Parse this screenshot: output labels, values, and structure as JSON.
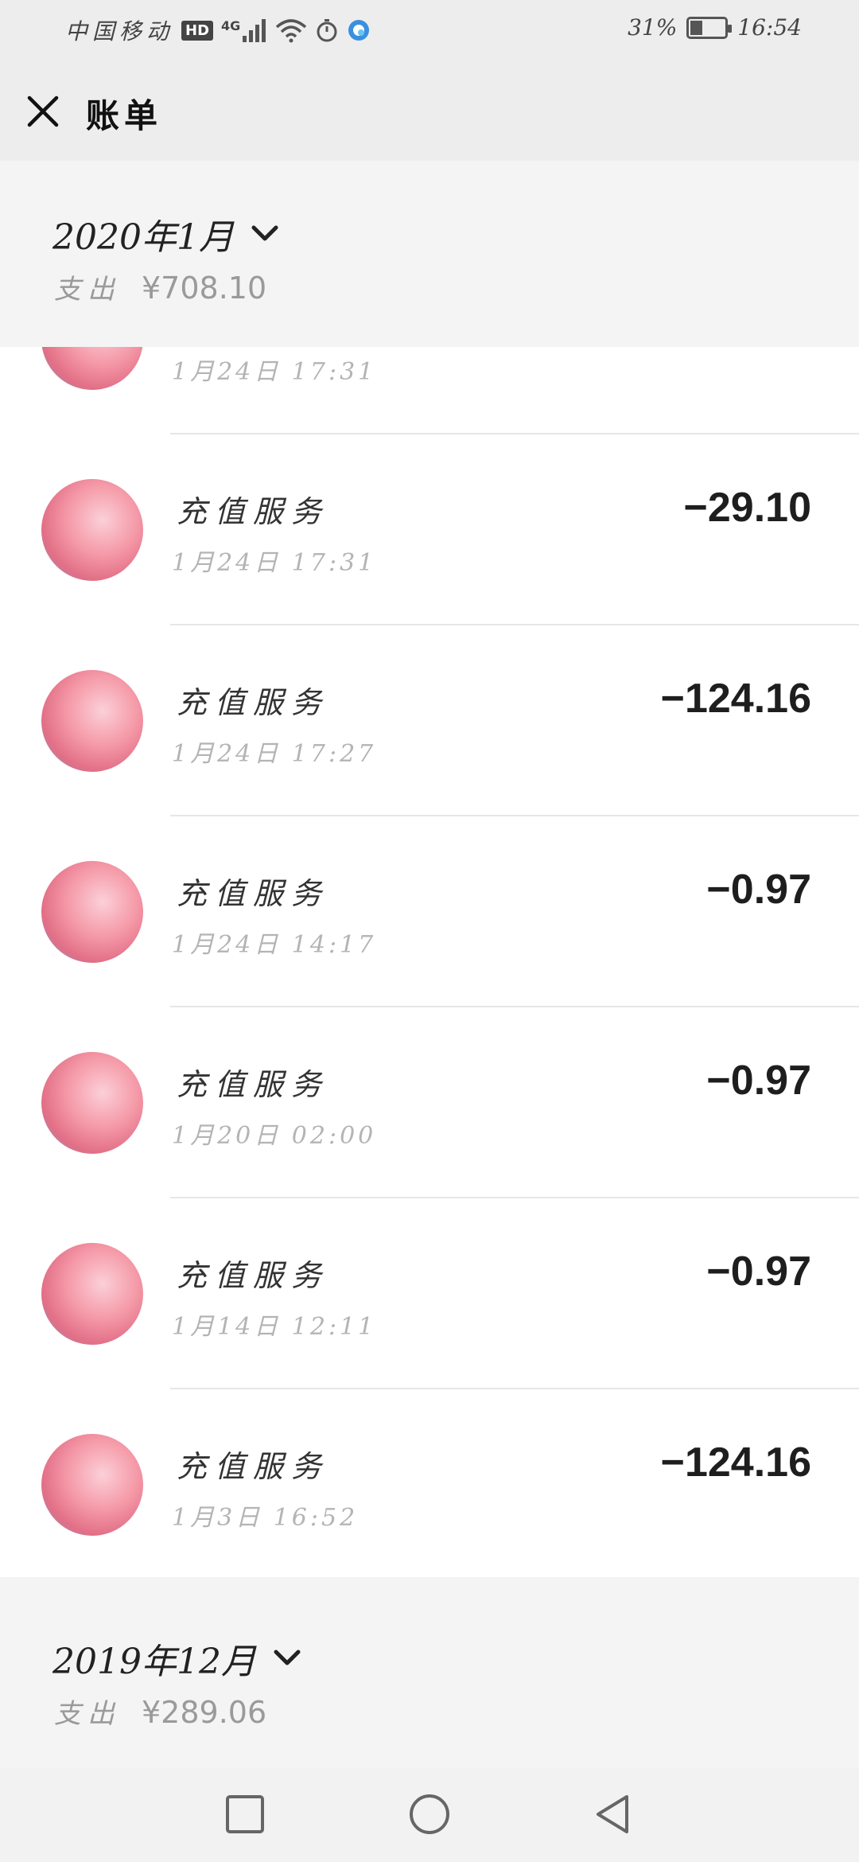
{
  "status_bar": {
    "carrier": "中国移动",
    "hd": "HD",
    "network": "4G",
    "battery": "31%",
    "time": "16:54"
  },
  "header": {
    "title": "账单"
  },
  "months": [
    {
      "title": "2020年1月",
      "expense_label": "支出",
      "expense_amount": "¥708.10"
    },
    {
      "title": "2019年12月",
      "expense_label": "支出",
      "expense_amount": "¥289.06"
    }
  ],
  "bills": [
    {
      "name": "",
      "time": "1月24日 17:31",
      "amount": ""
    },
    {
      "name": "充值服务",
      "time": "1月24日 17:31",
      "amount": "−29.10"
    },
    {
      "name": "充值服务",
      "time": "1月24日 17:27",
      "amount": "−124.16"
    },
    {
      "name": "充值服务",
      "time": "1月24日 14:17",
      "amount": "−0.97"
    },
    {
      "name": "充值服务",
      "time": "1月20日 02:00",
      "amount": "−0.97"
    },
    {
      "name": "充值服务",
      "time": "1月14日 12:11",
      "amount": "−0.97"
    },
    {
      "name": "充值服务",
      "time": "1月3日 16:52",
      "amount": "−124.16"
    }
  ],
  "icons": {
    "close": "close-icon",
    "chevron": "chevron-down-icon",
    "nav_recent": "square-icon",
    "nav_home": "circle-icon",
    "nav_back": "triangle-back-icon"
  }
}
